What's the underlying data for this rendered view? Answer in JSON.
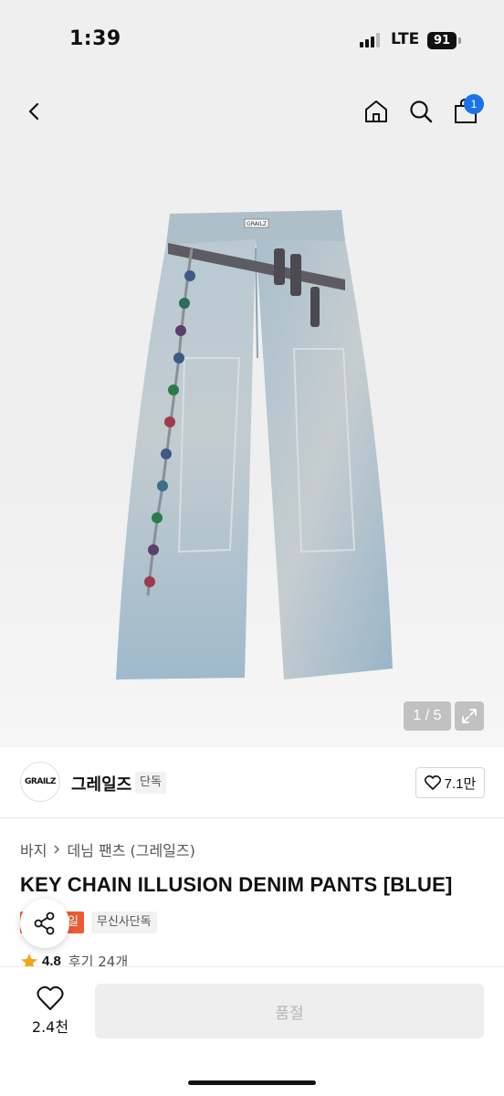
{
  "status_bar": {
    "time": "1:39",
    "network": "LTE",
    "battery": "91"
  },
  "header": {
    "back_icon": "chevron-left-icon",
    "home_icon": "home-icon",
    "search_icon": "search-icon",
    "cart_icon": "shopping-bag-icon",
    "cart_count": "1"
  },
  "gallery": {
    "page_indicator": "1 / 5",
    "expand_icon": "expand-arrows-icon",
    "logo_tag": "GRAILZ"
  },
  "brand": {
    "logo_text": "GRAILZ",
    "name": "그레일즈",
    "tag": "단독",
    "like_icon": "heart-outline-icon",
    "like_count": "7.1만"
  },
  "breadcrumb": {
    "items": [
      "바지",
      "데님 팬츠 (그레일즈)"
    ]
  },
  "product": {
    "title": "KEY CHAIN ILLUSION DENIM PANTS [BLUE]",
    "badges": {
      "sale": "세일",
      "exclusive": "무신사단독"
    },
    "share_icon": "share-icon",
    "rating": "4.8",
    "reviews": "후기 24개"
  },
  "bottom_bar": {
    "wish_count": "2.4천",
    "buy_label": "품절"
  },
  "colors": {
    "accent_blue": "#1a73e8",
    "sale_orange": "#ec5b34",
    "star": "#f2a51a"
  }
}
